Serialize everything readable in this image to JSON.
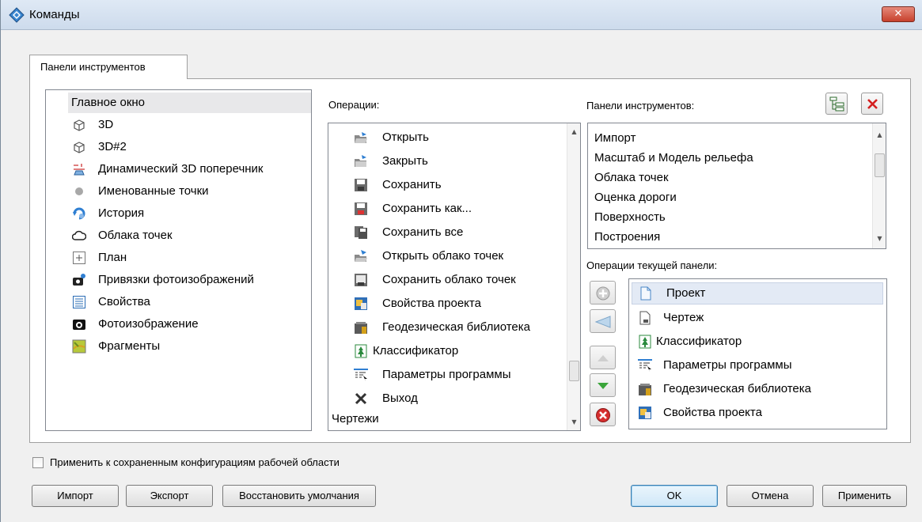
{
  "window": {
    "title": "Команды",
    "close_label": "✕"
  },
  "tab": {
    "label": "Панели инструментов"
  },
  "left_list": {
    "items": [
      {
        "label": "Главное окно",
        "icon": "none",
        "selected": true
      },
      {
        "label": "3D",
        "icon": "cube-icon"
      },
      {
        "label": "3D#2",
        "icon": "cube-icon"
      },
      {
        "label": "Динамический 3D поперечник",
        "icon": "cross-section-icon"
      },
      {
        "label": "Именованные точки",
        "icon": "point-icon"
      },
      {
        "label": "История",
        "icon": "history-icon"
      },
      {
        "label": "Облака точек",
        "icon": "cloud-icon"
      },
      {
        "label": "План",
        "icon": "plan-icon"
      },
      {
        "label": "Привязки фотоизображений",
        "icon": "photo-binding-icon"
      },
      {
        "label": "Свойства",
        "icon": "properties-icon"
      },
      {
        "label": "Фотоизображение",
        "icon": "camera-icon"
      },
      {
        "label": "Фрагменты",
        "icon": "fragments-icon"
      }
    ]
  },
  "operations": {
    "label": "Операции:",
    "items": [
      {
        "label": "Открыть",
        "icon": "open-folder-icon"
      },
      {
        "label": "Закрыть",
        "icon": "close-folder-icon"
      },
      {
        "label": "Сохранить",
        "icon": "save-icon"
      },
      {
        "label": "Сохранить как...",
        "icon": "save-as-icon"
      },
      {
        "label": "Сохранить все",
        "icon": "save-all-icon"
      },
      {
        "label": "Открыть облако точек",
        "icon": "open-cloud-icon"
      },
      {
        "label": "Сохранить облако точек",
        "icon": "save-cloud-icon"
      },
      {
        "label": "Свойства проекта",
        "icon": "project-properties-icon"
      },
      {
        "label": "Геодезическая библиотека",
        "icon": "library-icon"
      },
      {
        "label": "Классификатор",
        "icon": "classifier-icon"
      },
      {
        "label": "Параметры программы",
        "icon": "settings-icon"
      },
      {
        "label": "Выход",
        "icon": "exit-icon"
      }
    ],
    "group_label": "Чертежи"
  },
  "toolbars": {
    "label": "Панели инструментов:",
    "items": [
      "Импорт",
      "Масштаб и Модель рельефа",
      "Облака точек",
      "Оценка дороги",
      "Поверхность",
      "Построения"
    ]
  },
  "current_panel": {
    "label": "Операции текущей панели:",
    "items": [
      {
        "label": "Проект",
        "icon": "document-icon",
        "selected": true
      },
      {
        "label": "Чертеж",
        "icon": "drawing-icon"
      },
      {
        "label": "Классификатор",
        "icon": "classifier-icon"
      },
      {
        "label": "Параметры программы",
        "icon": "settings-icon"
      },
      {
        "label": "Геодезическая библиотека",
        "icon": "library-icon"
      },
      {
        "label": "Свойства проекта",
        "icon": "project-properties-icon"
      }
    ]
  },
  "apply_all": {
    "label": "Применить к сохраненным конфигурациям рабочей области",
    "checked": false
  },
  "buttons": {
    "import": "Импорт",
    "export": "Экспорт",
    "restore": "Восстановить умолчания",
    "ok": "OK",
    "cancel": "Отмена",
    "apply": "Применить"
  },
  "colors": {
    "accent": "#3c7fb1",
    "close_red": "#c7412d",
    "selection": "#e3eaf5"
  }
}
